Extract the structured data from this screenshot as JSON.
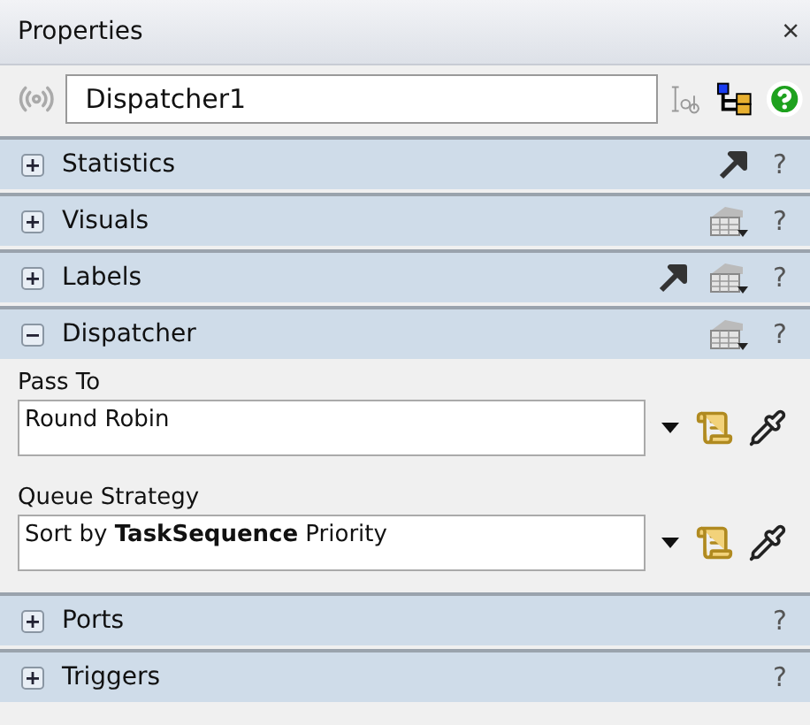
{
  "panel": {
    "title": "Properties",
    "close": "×"
  },
  "name_field": {
    "value": "Dispatcher1"
  },
  "sections": [
    {
      "title": "Statistics",
      "expanded": false,
      "icons": [
        {
          "kind": "arrow"
        }
      ],
      "help": "?"
    },
    {
      "title": "Visuals",
      "expanded": false,
      "icons": [
        {
          "kind": "table"
        }
      ],
      "help": "?"
    },
    {
      "title": "Labels",
      "expanded": false,
      "icons": [
        {
          "kind": "arrow"
        },
        {
          "kind": "table"
        }
      ],
      "help": "?"
    },
    {
      "title": "Dispatcher",
      "expanded": true,
      "icons": [
        {
          "kind": "table"
        }
      ],
      "help": "?",
      "fields": [
        {
          "label": "Pass To",
          "value": "Round Robin"
        },
        {
          "label": "Queue Strategy",
          "value": "Sort by **TaskSequence** Priority"
        }
      ]
    },
    {
      "title": "Ports",
      "expanded": false,
      "help": "?"
    },
    {
      "title": "Triggers",
      "expanded": false,
      "help": "?"
    }
  ]
}
